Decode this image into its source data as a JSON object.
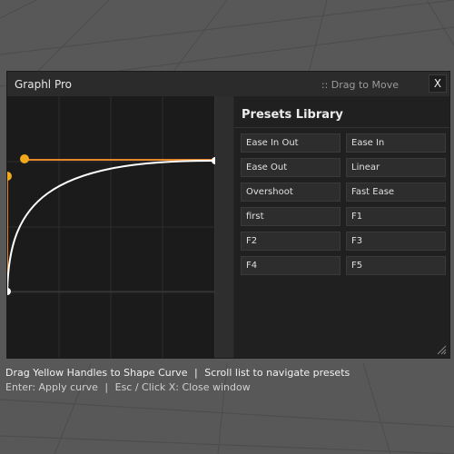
{
  "window": {
    "title": "Graphl Pro",
    "drag_hint": ":: Drag to Move",
    "close_label": "X"
  },
  "library": {
    "title": "Presets Library",
    "presets": [
      "Ease In Out",
      "Ease In",
      "Ease Out",
      "Linear",
      "Overshoot",
      "Fast Ease",
      "first",
      "F1",
      "F2",
      "F3",
      "F4",
      "F5"
    ]
  },
  "status": {
    "line1_left": "Drag Yellow Handles to Shape Curve",
    "line1_sep": "|",
    "line1_right": "Scroll list to navigate presets",
    "line2_left": "Enter: Apply curve",
    "line2_sep": "|",
    "line2_right": "Esc / Click X: Close window"
  },
  "colors": {
    "handle": "#f0a81c",
    "handle_line": "#e8862a",
    "curve": "#ffffff",
    "endpoint": "#ffffff"
  }
}
